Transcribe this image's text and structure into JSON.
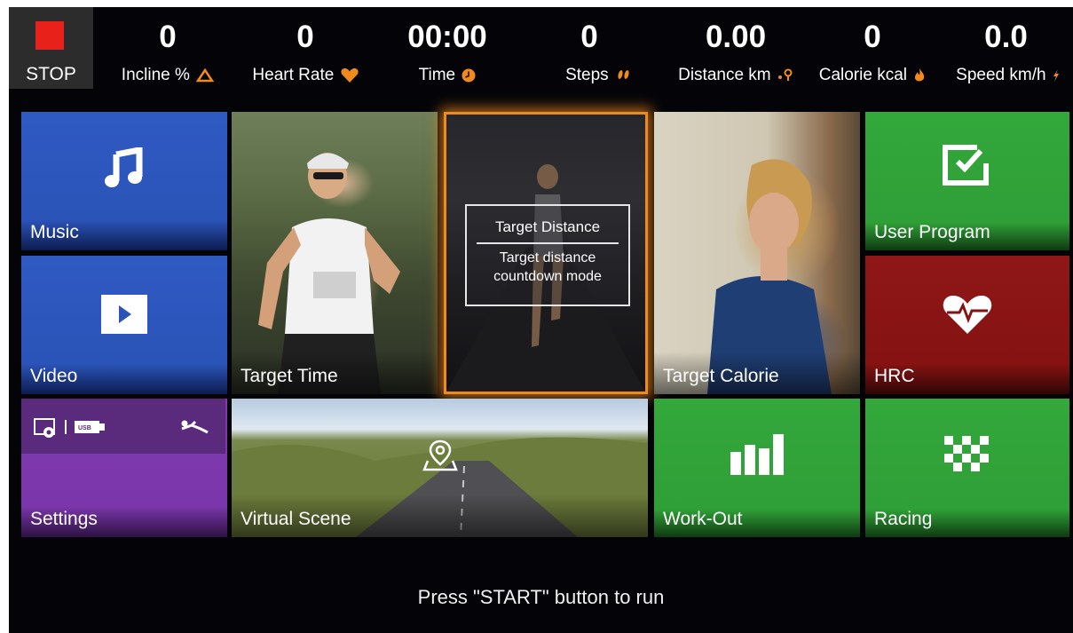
{
  "stop": {
    "label": "STOP",
    "color": "#e8211b"
  },
  "stats": [
    {
      "value": "0",
      "label": "Incline %",
      "icon": "incline-icon"
    },
    {
      "value": "0",
      "label": "Heart Rate",
      "icon": "heart-icon"
    },
    {
      "value": "00:00",
      "label": "Time",
      "icon": "clock-icon"
    },
    {
      "value": "0",
      "label": "Steps",
      "icon": "footsteps-icon"
    },
    {
      "value": "0.00",
      "label": "Distance km",
      "icon": "distance-icon"
    },
    {
      "value": "0",
      "label": "Calorie kcal",
      "icon": "flame-icon"
    },
    {
      "value": "0.0",
      "label": "Speed km/h",
      "icon": "speed-icon"
    }
  ],
  "accent_color": "#f08a1c",
  "tiles": {
    "music": {
      "label": "Music",
      "icon": "music-note-icon"
    },
    "video": {
      "label": "Video",
      "icon": "play-icon"
    },
    "settings": {
      "label": "Settings",
      "icons": [
        "settings-screen-icon",
        "usb-icon",
        "swimmer-icon"
      ]
    },
    "target_time": {
      "label": "Target Time"
    },
    "target_distance": {
      "title": "Target Distance",
      "description_line1": "Target distance",
      "description_line2": "countdown mode"
    },
    "target_calorie": {
      "label": "Target Calorie"
    },
    "virtual_scene": {
      "label": "Virtual Scene",
      "icon": "map-pin-icon"
    },
    "user_program": {
      "label": "User Program",
      "icon": "checkbox-edit-icon"
    },
    "hrc": {
      "label": "HRC",
      "icon": "heart-pulse-icon"
    },
    "work_out": {
      "label": "Work-Out",
      "icon": "bar-chart-icon"
    },
    "racing": {
      "label": "Racing",
      "icon": "checkered-flag-icon"
    }
  },
  "footer": {
    "message": "Press \"START\" button to run"
  }
}
